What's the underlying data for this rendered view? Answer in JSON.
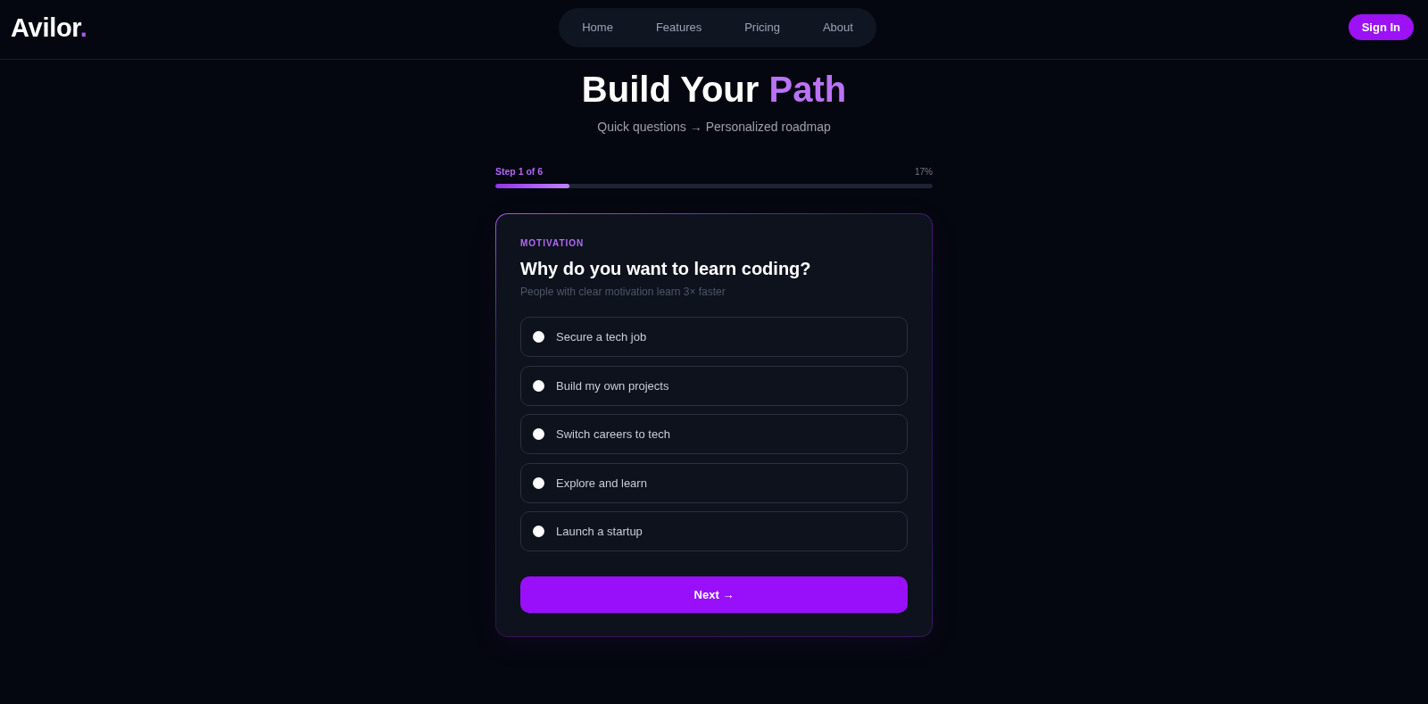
{
  "header": {
    "logo": {
      "name": "Avilor",
      "accent": "."
    },
    "nav": [
      "Home",
      "Features",
      "Pricing",
      "About"
    ],
    "sign_in": "Sign In"
  },
  "hero": {
    "title": "Build Your",
    "title_accent": "Path",
    "subtitle": "Quick questions → Personalized roadmap"
  },
  "progress": {
    "step": "Step 1 of 6",
    "percent": "17%",
    "level": 0.17
  },
  "question": {
    "category": "MOTIVATION",
    "title": "Why do you want to learn coding?",
    "hint": "People with clear motivation learn 3× faster",
    "options": [
      {
        "label": "Secure a tech job",
        "selected": false
      },
      {
        "label": "Build my own projects",
        "selected": false
      },
      {
        "label": "Switch careers to tech",
        "selected": false
      },
      {
        "label": "Explore and learn",
        "selected": false
      },
      {
        "label": "Launch a startup",
        "selected": false
      }
    ],
    "next_button": "Next →"
  }
}
